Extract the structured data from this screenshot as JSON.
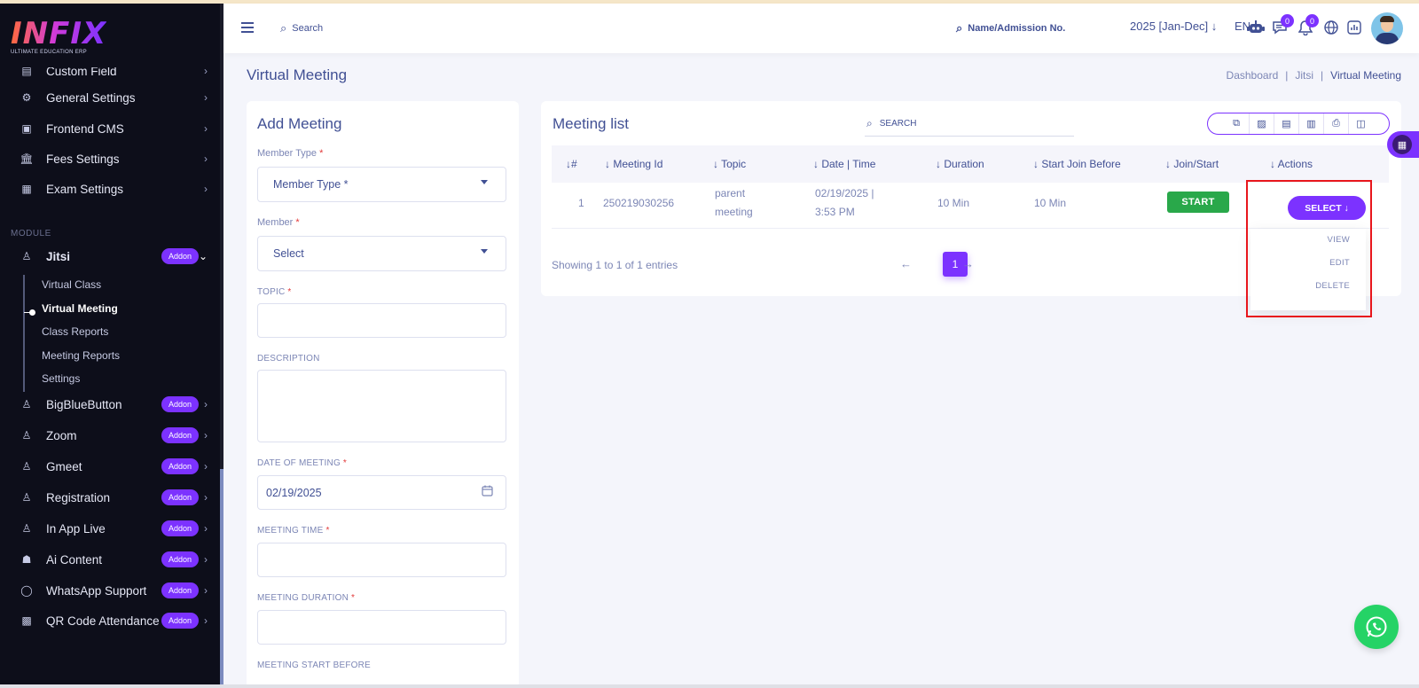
{
  "app": {
    "logo_text": "INFIX",
    "logo_tagline": "ULTIMATE EDUCATION ERP"
  },
  "sidebar": {
    "items_top": [
      {
        "label": "Custom Field",
        "icon": "form-icon"
      },
      {
        "label": "General Settings",
        "icon": "gears-icon"
      },
      {
        "label": "Frontend CMS",
        "icon": "monitor-icon"
      },
      {
        "label": "Fees Settings",
        "icon": "bank-icon"
      },
      {
        "label": "Exam Settings",
        "icon": "book-icon"
      }
    ],
    "module_label": "MODULE",
    "jitsi": {
      "label": "Jitsi",
      "badge": "Addon"
    },
    "jitsi_sub": [
      "Virtual Class",
      "Virtual Meeting",
      "Class Reports",
      "Meeting Reports",
      "Settings"
    ],
    "addons": [
      {
        "label": "BigBlueButton",
        "badge": "Addon"
      },
      {
        "label": "Zoom",
        "badge": "Addon"
      },
      {
        "label": "Gmeet",
        "badge": "Addon"
      },
      {
        "label": "Registration",
        "badge": "Addon"
      },
      {
        "label": "In App Live",
        "badge": "Addon"
      },
      {
        "label": "Ai Content",
        "badge": "Addon"
      },
      {
        "label": "WhatsApp Support",
        "badge": "Addon"
      },
      {
        "label": "QR Code Attendance",
        "badge": "Addon"
      }
    ]
  },
  "header": {
    "search": "Search",
    "admission_search": "Name/Admission No.",
    "session": "2025 [Jan-Dec]",
    "language": "EN",
    "chat_count": "0",
    "notification_count": "0"
  },
  "page": {
    "title": "Virtual Meeting",
    "breadcrumb": [
      "Dashboard",
      "Jitsi",
      "Virtual Meeting"
    ]
  },
  "form": {
    "title": "Add Meeting",
    "member_type_label": "Member Type",
    "member_type_value": "Member Type *",
    "member_label": "Member",
    "member_value": "Select",
    "topic_label": "TOPIC",
    "description_label": "DESCRIPTION",
    "date_label": "DATE OF MEETING",
    "date_value": "02/19/2025",
    "time_label": "MEETING TIME",
    "duration_label": "MEETING DURATION",
    "start_before_label": "MEETING START BEFORE",
    "required_mark": "*"
  },
  "list": {
    "title": "Meeting list",
    "search_placeholder": "SEARCH",
    "columns": [
      "#",
      "Meeting Id",
      "Topic",
      "Date | Time",
      "Duration",
      "Start Join Before",
      "Join/Start",
      "Actions"
    ],
    "rows": [
      {
        "num": "1",
        "meeting_id": "250219030256",
        "topic_line1": "parent",
        "topic_line2": "meeting",
        "date_line1": "02/19/2025 |",
        "date_line2": "3:53 PM",
        "duration": "10 Min",
        "join_before": "10 Min",
        "start_label": "START"
      }
    ],
    "showing": "Showing 1 to 1 of 1 entries",
    "current_page": "1",
    "select_label": "SELECT",
    "actions": [
      "VIEW",
      "EDIT",
      "DELETE"
    ]
  },
  "colors": {
    "accent": "#7c32ff",
    "sidebar_bg": "#0d0e1a",
    "text": "#415094",
    "success": "#29a84a",
    "highlight": "#e8161c",
    "whatsapp": "#25d366"
  }
}
